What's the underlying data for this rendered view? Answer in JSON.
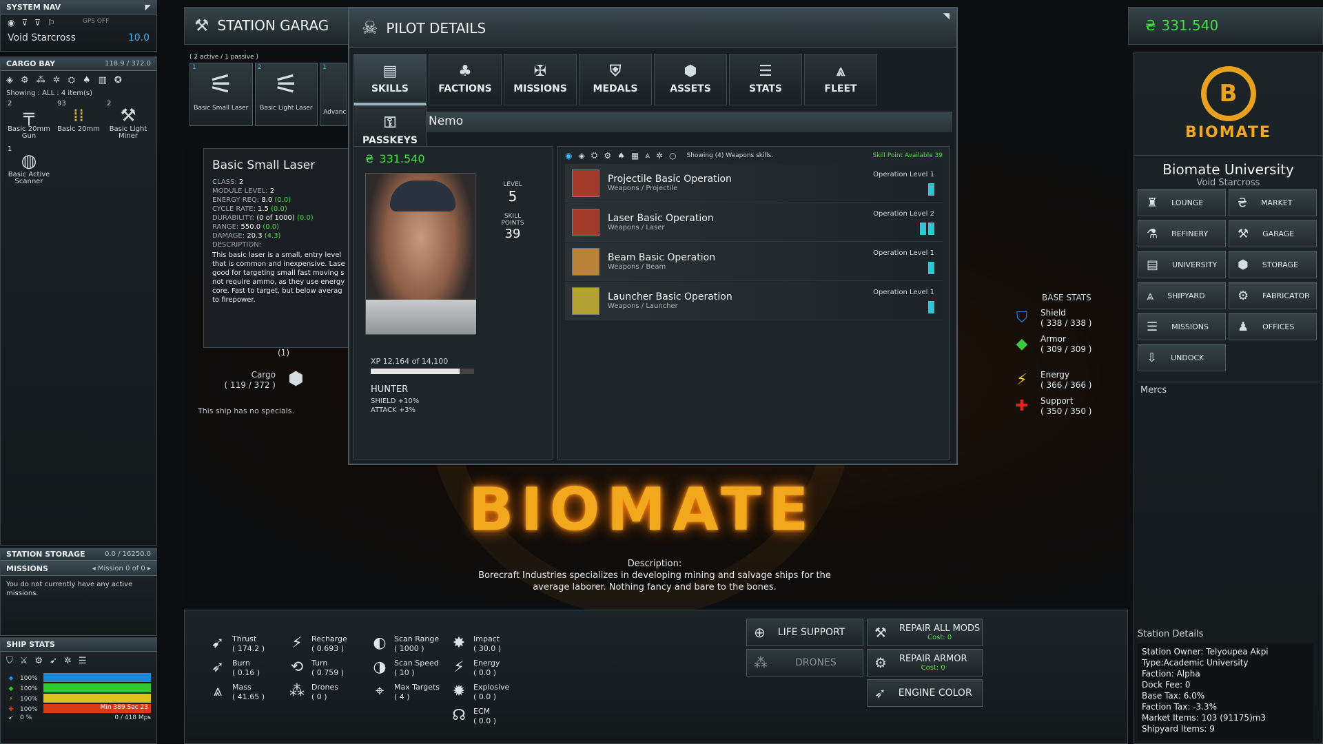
{
  "credits": "331.540",
  "system_nav": {
    "title": "SYSTEM NAV",
    "gps": "GPS OFF",
    "location": "Void Starcross",
    "security": "10.0"
  },
  "cargo_bay": {
    "title": "CARGO BAY",
    "capacity": "118.9 / 372.0",
    "showing": "Showing : ALL : 4 item(s)",
    "items": [
      {
        "count": "2",
        "label": "Basic 20mm Gun"
      },
      {
        "count": "93",
        "label": "Basic 20mm"
      },
      {
        "count": "2",
        "label": "Basic Light Miner"
      },
      {
        "count": "1",
        "label": "Basic Active Scanner"
      }
    ]
  },
  "station_storage": {
    "title": "STATION STORAGE",
    "capacity": "0.0 / 16250.0"
  },
  "missions_panel": {
    "title": "MISSIONS",
    "nav": "Mission 0 of 0",
    "text": "You do not currently have any active missions."
  },
  "ship_stats": {
    "title": "SHIP STATS",
    "rows": [
      {
        "pct": "100%",
        "color": "#1e88d8",
        "text": ""
      },
      {
        "pct": "100%",
        "color": "#32c832",
        "text": ""
      },
      {
        "pct": "100%",
        "color": "#e0c21c",
        "text": ""
      },
      {
        "pct": "100%",
        "color": "#d93a1a",
        "text": "Min 389 Sec 23"
      },
      {
        "pct": "0 %",
        "color": "",
        "text": "0  /  418 Mps"
      }
    ]
  },
  "garage": {
    "title": "STATION GARAG",
    "active": "( 2 active  /  1 passive )",
    "slots": [
      {
        "num": "1",
        "label": "Basic Small Laser"
      },
      {
        "num": "2",
        "label": "Basic Light Laser"
      },
      {
        "num": "1",
        "label": "Advanc"
      }
    ],
    "cargo_label": "Cargo",
    "cargo_value": "( 119 / 372 )",
    "slot_count": "(1)",
    "no_specials": "This ship has no specials."
  },
  "tooltip": {
    "title": "Basic Small Laser",
    "lines": [
      {
        "k": "CLASS:",
        "v": "2",
        "d": ""
      },
      {
        "k": "MODULE LEVEL:",
        "v": "2",
        "d": ""
      },
      {
        "k": "ENERGY REQ:",
        "v": "8.0",
        "d": "(0.0)"
      },
      {
        "k": "CYCLE RATE:",
        "v": "1.5",
        "d": "(0.0)"
      },
      {
        "k": "DURABILITY:",
        "v": "(0 of 1000)",
        "d": "(0.0)"
      },
      {
        "k": "RANGE:",
        "v": "550.0",
        "d": "(0.0)"
      },
      {
        "k": "DAMAGE:",
        "v": "20.3",
        "d": "(4.3)"
      },
      {
        "k": "DESCRIPTION:",
        "v": "",
        "d": ""
      }
    ],
    "description": "This basic laser is a small, entry level that is common and inexpensive. Lase good for targeting small fast moving s not require ammo, as they use energy core. Fast to target, but below averag to firepower."
  },
  "pilot": {
    "title": "PILOT DETAILS",
    "tabs": [
      "SKILLS",
      "FACTIONS",
      "MISSIONS",
      "MEDALS",
      "ASSETS",
      "STATS",
      "FLEET",
      "PASSKEYS"
    ],
    "name": "Nemo",
    "credits": "331.540",
    "level_label": "LEVEL",
    "level": "5",
    "sp_label": "SKILL POINTS",
    "sp": "39",
    "xp": "XP  12,164  of  14,100",
    "xp_fraction": 0.86,
    "class_name": "HUNTER",
    "bonus1": "SHIELD +10%",
    "bonus2": "ATTACK +3%",
    "showing": "Showing (4) Weapons skills.",
    "sp_available": "Skill Point Available  39",
    "skills": [
      {
        "name": "Projectile Basic Operation",
        "sub": "Weapons / Projectile",
        "level": "Operation Level 1",
        "pips": 1,
        "thumb": "#a43a2c"
      },
      {
        "name": "Laser Basic Operation",
        "sub": "Weapons / Laser",
        "level": "Operation Level 2",
        "pips": 2,
        "thumb": "#a43a2c"
      },
      {
        "name": "Beam Basic Operation",
        "sub": "Weapons / Beam",
        "level": "Operation Level 1",
        "pips": 1,
        "thumb": "#b9823a"
      },
      {
        "name": "Launcher Basic Operation",
        "sub": "Weapons / Launcher",
        "level": "Operation Level 1",
        "pips": 1,
        "thumb": "#b5a234"
      }
    ]
  },
  "backdrop": {
    "logo": "BIOMATE",
    "desc_title": "Description:",
    "desc": "Borecraft Industries specializes in developing mining and salvage ships for the average laborer. Nothing fancy and bare to the bones."
  },
  "base_stats": {
    "title": "BASE STATS",
    "rows": [
      {
        "name": "Shield",
        "value": "( 338 / 338 )"
      },
      {
        "name": "Armor",
        "value": "( 309 / 309 )"
      },
      {
        "name": "Energy",
        "value": "( 366 / 366 )"
      },
      {
        "name": "Support",
        "value": "( 350 / 350 )"
      }
    ]
  },
  "station": {
    "logo": "BIOMATE",
    "name": "Biomate University",
    "system": "Void Starcross",
    "buttons": [
      "LOUNGE",
      "MARKET",
      "REFINERY",
      "GARAGE",
      "UNIVERSITY",
      "STORAGE",
      "SHIPYARD",
      "FABRICATOR",
      "MISSIONS",
      "OFFICES",
      "UNDOCK"
    ],
    "mercs": "Mercs",
    "details_title": "Station Details",
    "details": [
      "Station Owner: Telyoupea Akpi",
      "Type:Academic University",
      "Faction: Alpha",
      "Dock Fee: 0",
      "Base Tax: 6.0%",
      "Faction Tax: -3.3%",
      "Market Items: 103 (91175)m3",
      "Shipyard Items: 9"
    ]
  },
  "bottom_stats": [
    {
      "name": "Thrust",
      "value": "( 174.2 )"
    },
    {
      "name": "Burn",
      "value": "( 0.16 )"
    },
    {
      "name": "Mass",
      "value": "( 41.65 )"
    },
    {
      "name": "Recharge",
      "value": "( 0.693 )"
    },
    {
      "name": "Turn",
      "value": "( 0.759 )"
    },
    {
      "name": "Drones",
      "value": "( 0 )"
    },
    {
      "name": "Scan Range",
      "value": "( 1000 )"
    },
    {
      "name": "Scan Speed",
      "value": "( 10 )"
    },
    {
      "name": "Max Targets",
      "value": "( 4 )"
    },
    {
      "name": "Impact",
      "value": "( 30.0 )"
    },
    {
      "name": "Energy",
      "value": "( 0.0 )"
    },
    {
      "name": "Explosive",
      "value": "( 0.0 )"
    },
    {
      "name": "ECM",
      "value": "( 0.0 )"
    }
  ],
  "actions": {
    "life_support": "LIFE SUPPORT",
    "drones": "DRONES",
    "repair_mods": "REPAIR ALL MODS",
    "repair_mods_cost": "Cost: 0",
    "repair_armor": "REPAIR ARMOR",
    "repair_armor_cost": "Cost: 0",
    "engine_color": "ENGINE COLOR"
  }
}
